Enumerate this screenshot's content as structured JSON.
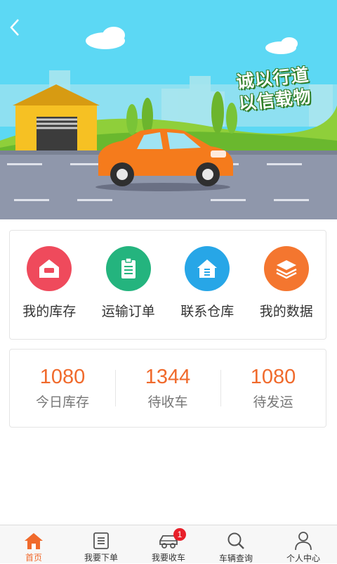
{
  "banner": {
    "slogan_line1": "诚以行道",
    "slogan_line2": "以信载物"
  },
  "menu": [
    {
      "label": "我的库存",
      "icon": "warehouse-icon",
      "color": "#ef4a5c"
    },
    {
      "label": "运输订单",
      "icon": "clipboard-icon",
      "color": "#24b47e"
    },
    {
      "label": "联系仓库",
      "icon": "house-icon",
      "color": "#27a6e7"
    },
    {
      "label": "我的数据",
      "icon": "layers-icon",
      "color": "#f4762f"
    }
  ],
  "stats": [
    {
      "value": "1080",
      "label": "今日库存"
    },
    {
      "value": "1344",
      "label": "待收车"
    },
    {
      "value": "1080",
      "label": "待发运"
    }
  ],
  "tabs": [
    {
      "label": "首页",
      "icon": "home-icon",
      "active": true
    },
    {
      "label": "我要下单",
      "icon": "list-icon"
    },
    {
      "label": "我要收车",
      "icon": "car-icon",
      "badge": "1"
    },
    {
      "label": "车辆查询",
      "icon": "search-icon"
    },
    {
      "label": "个人中心",
      "icon": "person-icon"
    }
  ],
  "colors": {
    "accent": "#f06a2c",
    "badge": "#e8202a"
  }
}
